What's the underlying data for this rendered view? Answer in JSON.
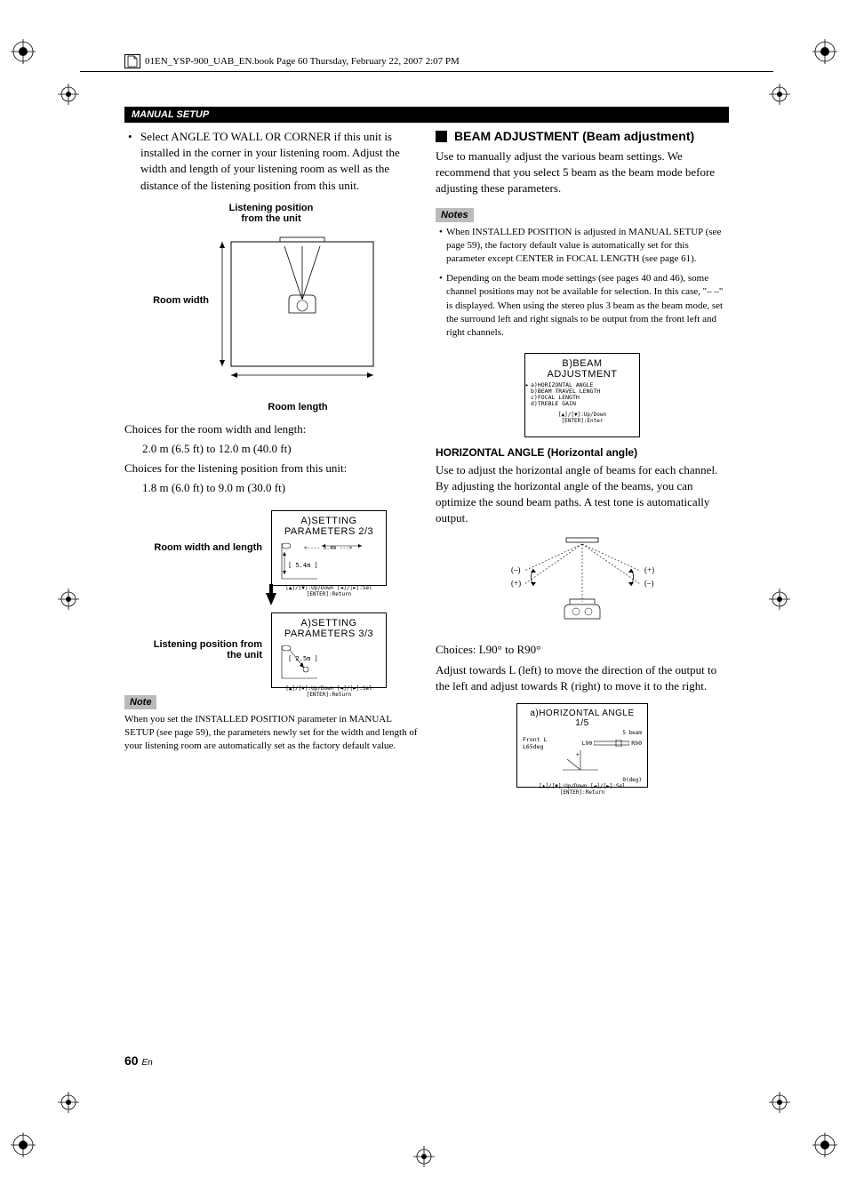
{
  "header": {
    "file_info": "01EN_YSP-900_UAB_EN.book  Page 60  Thursday, February 22, 2007  2:07 PM"
  },
  "section_header": "MANUAL SETUP",
  "left": {
    "bullet1": "Select ANGLE TO WALL OR CORNER if this unit is installed in the corner in your listening room. Adjust the width and length of your listening room as well as the distance of the listening position from this unit.",
    "diagram1": {
      "top_label1": "Listening position",
      "top_label2": "from the unit",
      "left_label": "Room width",
      "bottom_label": "Room length"
    },
    "choices1_label": "Choices for the room width and length:",
    "choices1_range": "2.0 m (6.5 ft) to 12.0 m (40.0 ft)",
    "choices2_label": "Choices for the listening position from this unit:",
    "choices2_range": "1.8 m (6.0 ft) to 9.0 m (30.0 ft)",
    "side_label1": "Room width and length",
    "side_label2a": "Listening position from",
    "side_label2b": "the unit",
    "screen1": {
      "title": "A)SETTING PARAMETERS 2/3",
      "line1": "<---- 5.4m --->",
      "line2": "[ 5.4m ]",
      "hint1": "[▲]/[▼]:Up/Down [◄]/[►]:Sel",
      "hint2": "[ENTER]:Return"
    },
    "screen2": {
      "title": "A)SETTING PARAMETERS 3/3",
      "line1": "[ 2.5m ]",
      "hint1": "[▲]/[▼]:Up/Down [◄]/[►]:Sel",
      "hint2": "[ENTER]:Return"
    },
    "note_label": "Note",
    "note_text": "When you set the INSTALLED POSITION parameter in MANUAL SETUP (see page 59), the parameters newly set for the width and length of your listening room are automatically set as the factory default value."
  },
  "right": {
    "heading1": "BEAM ADJUSTMENT (Beam adjustment)",
    "para1": "Use to manually adjust the various beam settings. We recommend that you select 5 beam as the beam mode before adjusting these parameters.",
    "notes_label": "Notes",
    "note_item1": "When INSTALLED POSITION is adjusted in MANUAL SETUP (see page 59), the factory default value is automatically set for this parameter except CENTER in FOCAL LENGTH (see page 61).",
    "note_item2": "Depending on the beam mode settings (see pages 40 and 46), some channel positions may not be available for selection. In this case, \"– –\" is displayed. When using the stereo plus 3 beam as the beam mode, set the surround left and right signals to be output from the front left and right channels.",
    "menu_screen": {
      "title": "B)BEAM ADJUSTMENT",
      "item_a": "a)HORIZONTAL ANGLE",
      "item_b": "b)BEAM TRAVEL LENGTH",
      "item_c": "c)FOCAL LENGTH",
      "item_d": "d)TREBLE GAIN",
      "hint1": "[▲]/[▼]:Up/Down",
      "hint2": "[ENTER]:Enter"
    },
    "subheading_ha": "HORIZONTAL ANGLE (Horizontal angle)",
    "para_ha": "Use to adjust the horizontal angle of beams for each channel. By adjusting the horizontal angle of the beams, you can optimize the sound beam paths. A test tone is automatically output.",
    "diag_minus": "(–)",
    "diag_plus": "(+)",
    "choices_ha": "Choices: L90° to R90°",
    "para_ha2": "Adjust towards L (left) to move the direction of the output to the left and adjust towards R (right) to move it to the right.",
    "ha_screen": {
      "title": "a)HORIZONTAL ANGLE 1/5",
      "beam": "5 beam",
      "front": "Front L",
      "deg": "L65deg",
      "l90": "L90",
      "r90": "R90",
      "zero": "0(deg)",
      "hint1": "[▲]/[▼]:Up/Down [◄]/[►]:Sel",
      "hint2": "[ENTER]:Return"
    }
  },
  "page_number": "60",
  "page_lang": "En"
}
